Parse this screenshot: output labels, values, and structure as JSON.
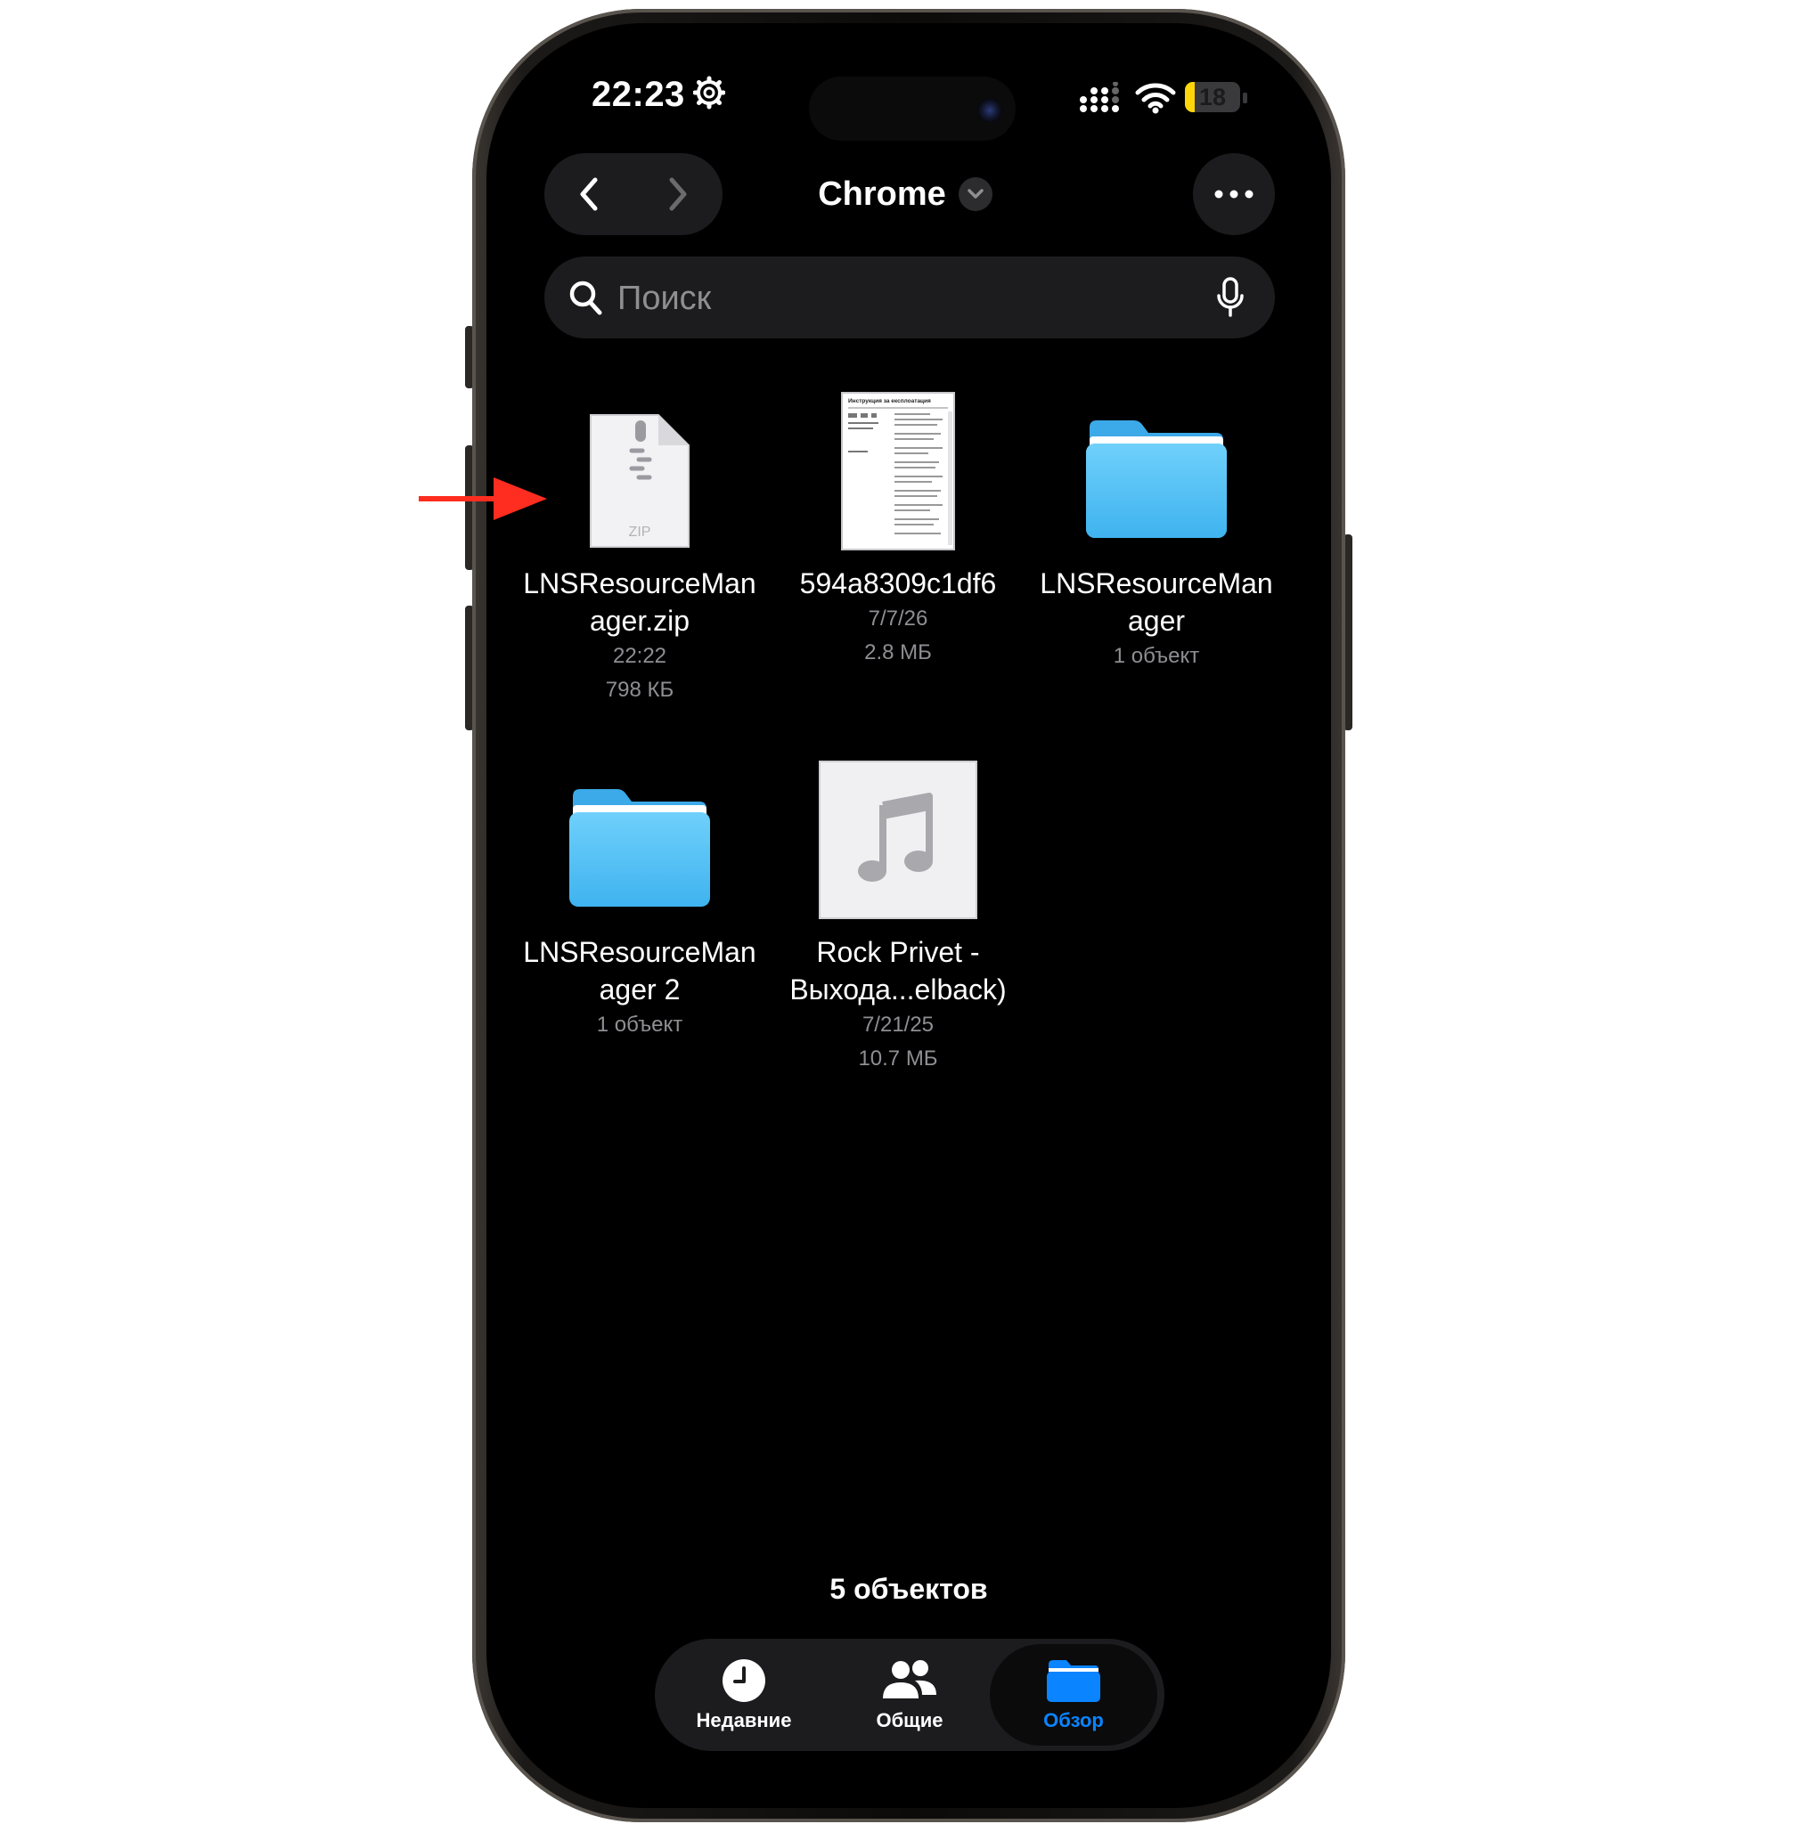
{
  "status_bar": {
    "time": "22:23",
    "battery_level": "18",
    "battery_fraction": 0.18
  },
  "navigation": {
    "title": "Chrome",
    "back_icon": "chevron-left-icon",
    "forward_icon": "chevron-right-icon",
    "more_icon": "ellipsis-icon"
  },
  "search": {
    "placeholder": "Поиск",
    "value": ""
  },
  "items": [
    {
      "name_lines": [
        "LNSResourceMan",
        "ager.zip"
      ],
      "meta": [
        "22:22",
        "798 КБ"
      ],
      "kind": "zip-file",
      "badge": "ZIP"
    },
    {
      "name_lines": [
        "594a8309c1df6"
      ],
      "meta": [
        "7/7/26",
        "2.8 МБ"
      ],
      "kind": "pdf-document",
      "doc_title": "Инструкция за експлоатация"
    },
    {
      "name_lines": [
        "LNSResourceMan",
        "ager"
      ],
      "meta": [
        "1 объект"
      ],
      "kind": "folder"
    },
    {
      "name_lines": [
        "LNSResourceMan",
        "ager 2"
      ],
      "meta": [
        "1 объект"
      ],
      "kind": "folder"
    },
    {
      "name_lines": [
        "Rock Privet -",
        "Выхода...elback)"
      ],
      "meta": [
        "7/21/25",
        "10.7 МБ"
      ],
      "kind": "audio-file"
    }
  ],
  "footer": {
    "count": "5 объектов"
  },
  "tabbar": {
    "tabs": [
      {
        "label": "Недавние",
        "icon": "clock-icon",
        "selected": false
      },
      {
        "label": "Общие",
        "icon": "people-icon",
        "selected": false
      },
      {
        "label": "Обзор",
        "icon": "folder-icon",
        "selected": true
      }
    ]
  },
  "colors": {
    "accent": "#0a84ff",
    "folder": "#5ac8fa",
    "background": "#000000",
    "annotation": "#ff2d20"
  }
}
